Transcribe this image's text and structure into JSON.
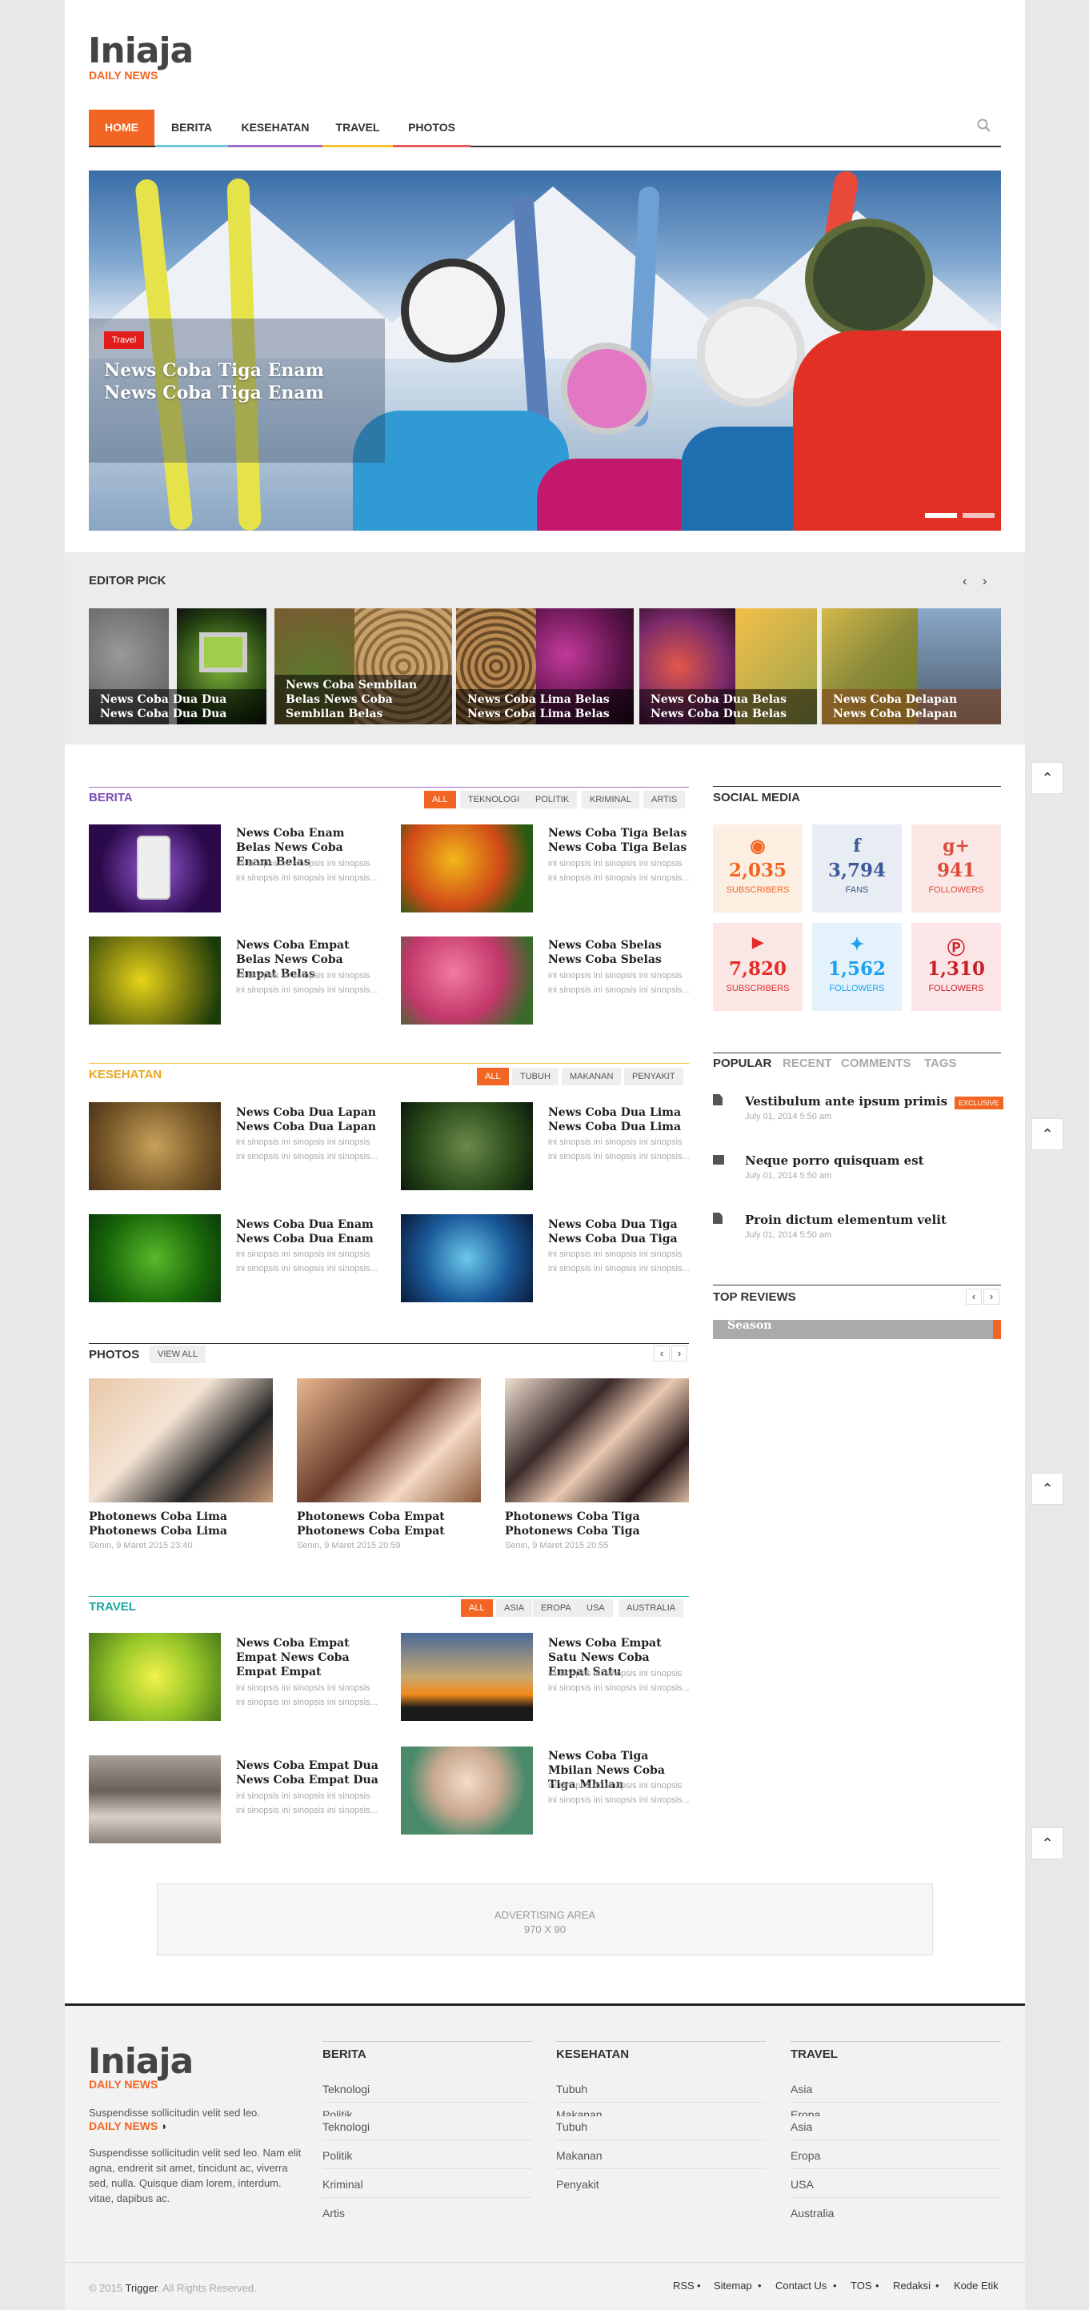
{
  "header": {
    "logo": "Iniaja",
    "tagline": "DAILY NEWS"
  },
  "nav": {
    "items": [
      {
        "label": "HOME",
        "color": "#f26522"
      },
      {
        "label": "BERITA",
        "color": "#6ec8d8"
      },
      {
        "label": "KESEHATAN",
        "color": "#9b6bc7"
      },
      {
        "label": "TRAVEL",
        "color": "#f4c430"
      },
      {
        "label": "PHOTOS",
        "color": "#e85858"
      }
    ],
    "search_icon": "search-icon"
  },
  "hero": {
    "tag": "Travel",
    "title": "News Coba Tiga Enam News Coba Tiga Enam"
  },
  "editor_pick": {
    "title": "EDITOR PICK",
    "items": [
      "News Coba Dua Dua News Coba Dua Dua",
      "News Coba Sembilan Belas News Coba Sembilan Belas",
      "News Coba Lima Belas News Coba Lima Belas",
      "News Coba Dua Belas News Coba Dua Belas",
      "News Coba Delapan News Coba Delapan"
    ]
  },
  "berita": {
    "title": "BERITA",
    "tags": [
      "ALL",
      "TEKNOLOGI",
      "POLITIK",
      "KRIMINAL",
      "ARTIS"
    ],
    "items": [
      {
        "title": "News Coba Enam Belas News Coba Enam Belas",
        "text": "ini sinopsis ini sinopsis ini sinopsis ini sinopsis ini sinopsis ini sinopsis..."
      },
      {
        "title": "News Coba Tiga Belas News Coba Tiga Belas",
        "text": "ini sinopsis ini sinopsis ini sinopsis ini sinopsis ini sinopsis ini sinopsis..."
      },
      {
        "title": "News Coba Empat Belas News Coba Empat Belas",
        "text": "ini sinopsis ini sinopsis ini sinopsis ini sinopsis ini sinopsis ini sinopsis..."
      },
      {
        "title": "News Coba Sbelas News Coba Sbelas",
        "text": "ini sinopsis ini sinopsis ini sinopsis ini sinopsis ini sinopsis ini sinopsis..."
      }
    ]
  },
  "kesehatan": {
    "title": "KESEHATAN",
    "tags": [
      "ALL",
      "TUBUH",
      "MAKANAN",
      "PENYAKIT"
    ],
    "items": [
      {
        "title": "News Coba Dua Lapan News Coba Dua Lapan",
        "text": "ini sinopsis ini sinopsis ini sinopsis ini sinopsis ini sinopsis ini sinopsis..."
      },
      {
        "title": "News Coba Dua Lima News Coba Dua Lima",
        "text": "ini sinopsis ini sinopsis ini sinopsis ini sinopsis ini sinopsis ini sinopsis..."
      },
      {
        "title": "News Coba Dua Enam News Coba Dua Enam",
        "text": "ini sinopsis ini sinopsis ini sinopsis ini sinopsis ini sinopsis ini sinopsis..."
      },
      {
        "title": "News Coba Dua Tiga News Coba Dua Tiga",
        "text": "ini sinopsis ini sinopsis ini sinopsis ini sinopsis ini sinopsis ini sinopsis..."
      }
    ]
  },
  "photos": {
    "title": "PHOTOS",
    "view_all": "VIEW ALL",
    "items": [
      {
        "title": "Photonews Coba Lima Photonews Coba Lima",
        "date": "Senin, 9 Maret 2015 23:40"
      },
      {
        "title": "Photonews Coba Empat Photonews Coba Empat",
        "date": "Senin, 9 Maret 2015 20:59"
      },
      {
        "title": "Photonews Coba Tiga Photonews Coba Tiga",
        "date": "Senin, 9 Maret 2015 20:55"
      }
    ]
  },
  "travel": {
    "title": "TRAVEL",
    "tags": [
      "ALL",
      "ASIA",
      "EROPA",
      "USA",
      "AUSTRALIA"
    ],
    "items": [
      {
        "title": "News Coba Empat Empat News Coba Empat Empat",
        "text": "ini sinopsis ini sinopsis ini sinopsis ini sinopsis ini sinopsis ini sinopsis..."
      },
      {
        "title": "News Coba Empat Satu News Coba Empat Satu",
        "text": "ini sinopsis ini sinopsis ini sinopsis ini sinopsis ini sinopsis ini sinopsis..."
      },
      {
        "title": "News Coba Empat Dua News Coba Empat Dua",
        "text": "ini sinopsis ini sinopsis ini sinopsis ini sinopsis ini sinopsis ini sinopsis..."
      },
      {
        "title": "News Coba Tiga Mbilan News Coba Tiga Mbilan",
        "text": "ini sinopsis ini sinopsis ini sinopsis ini sinopsis ini sinopsis ini sinopsis..."
      }
    ]
  },
  "ad": {
    "line1": "ADVERTISING AREA",
    "line2": "970 X 90"
  },
  "social": {
    "title": "SOCIAL MEDIA",
    "items": [
      {
        "icon": "rss-icon",
        "glyph": "◉",
        "count": "2,035",
        "label": "SUBSCRIBERS",
        "color": "#f26522",
        "bg": "#fdeee2"
      },
      {
        "icon": "facebook-icon",
        "glyph": "f",
        "count": "3,794",
        "label": "FANS",
        "color": "#3b5998",
        "bg": "#e8ecf3"
      },
      {
        "icon": "google-plus-icon",
        "glyph": "g+",
        "count": "941",
        "label": "FOLLOWERS",
        "color": "#dd4b39",
        "bg": "#fbe7e5"
      },
      {
        "icon": "youtube-icon",
        "glyph": "▶",
        "count": "7,820",
        "label": "SUBSCRIBERS",
        "color": "#e52d27",
        "bg": "#fbe6e6"
      },
      {
        "icon": "twitter-icon",
        "glyph": "✦",
        "count": "1,562",
        "label": "FOLLOWERS",
        "color": "#1da1f2",
        "bg": "#e4f3fb"
      },
      {
        "icon": "pinterest-icon",
        "glyph": "P",
        "count": "1,310",
        "label": "FOLLOWERS",
        "color": "#cb2027",
        "bg": "#fbe5e6"
      }
    ]
  },
  "tabs": {
    "items": [
      "POPULAR",
      "RECENT",
      "COMMENTS",
      "TAGS"
    ],
    "posts": [
      {
        "title": "Vestibulum ante ipsum primis",
        "date": "July 01, 2014 5:50 am",
        "badge": "EXCLUSIVE"
      },
      {
        "title": "Neque porro quisquam est",
        "date": "July 01, 2014 5:50 am"
      },
      {
        "title": "Proin dictum elementum velit",
        "date": "July 01, 2014 5:50 am"
      }
    ]
  },
  "top_reviews": {
    "title": "TOP REVIEWS",
    "item": "Season"
  },
  "footer": {
    "logo": "Iniaja",
    "tagline": "DAILY NEWS",
    "text_a": "Suspendisse sollicitudin velit sed leo.",
    "text_b": "Suspendisse sollicitudin velit sed leo. Nam elit agna, endrerit sit amet, tincidunt ac, viverra sed, nulla. Quisque diam lorem, interdum. vitae, dapibus ac.",
    "cols": [
      {
        "title": "BERITA",
        "a": [
          "Teknologi",
          "Politik"
        ],
        "b": [
          "Teknologi",
          "Politik",
          "Kriminal",
          "Artis"
        ]
      },
      {
        "title": "KESEHATAN",
        "a": [
          "Tubuh",
          "Makanan"
        ],
        "b": [
          "Tubuh",
          "Makanan",
          "Penyakit"
        ]
      },
      {
        "title": "TRAVEL",
        "a": [
          "Asia",
          "Eropa"
        ],
        "b": [
          "Asia",
          "Eropa",
          "USA",
          "Australia"
        ]
      }
    ],
    "copyright_pre": "© 2015 ",
    "copyright_brand": "Trigger",
    "copyright_post": ". All Rights Reserved.",
    "links": [
      "RSS",
      "Sitemap",
      "Contact Us",
      "TOS",
      "Redaksi",
      "Kode Etik"
    ]
  }
}
